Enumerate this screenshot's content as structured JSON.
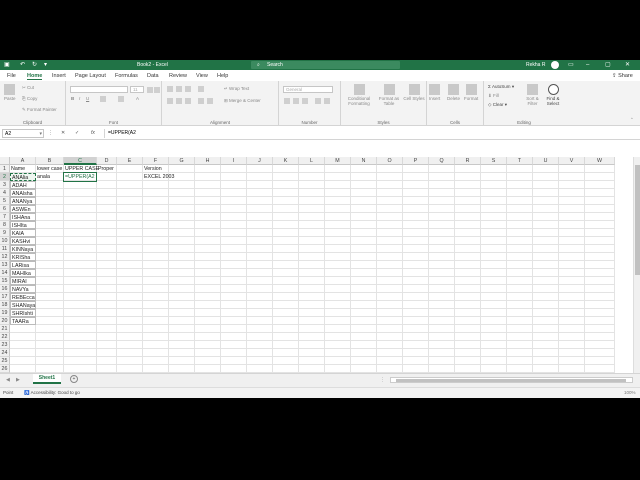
{
  "titlebar": {
    "doc_title": "Book2 - Excel",
    "search_placeholder": "Search",
    "user_name": "Rekha R"
  },
  "tabs": [
    "File",
    "Home",
    "Insert",
    "Page Layout",
    "Formulas",
    "Data",
    "Review",
    "View",
    "Help"
  ],
  "share_label": "Share",
  "ribbon": {
    "clipboard": {
      "paste": "Paste",
      "cut": "Cut",
      "copy": "Copy",
      "format_painter": "Format Painter",
      "group": "Clipboard"
    },
    "font": {
      "group": "Font",
      "size": "11"
    },
    "alignment": {
      "wrap": "Wrap Text",
      "merge": "Merge & Center",
      "group": "Alignment"
    },
    "number": {
      "format": "General",
      "group": "Number"
    },
    "styles": {
      "cond": "Conditional Formatting",
      "table": "Format as Table",
      "cell": "Cell Styles",
      "group": "Styles"
    },
    "cells": {
      "insert": "Insert",
      "delete": "Delete",
      "format": "Format",
      "group": "Cells"
    },
    "editing": {
      "autosum": "AutoSum",
      "fill": "Fill",
      "clear": "Clear",
      "sort": "Sort & Filter",
      "find": "Find & Select",
      "group": "Editing"
    }
  },
  "formula_bar": {
    "name_box": "A2",
    "formula": "=UPPER(A2"
  },
  "sheet": {
    "columns": [
      "A",
      "B",
      "C",
      "D",
      "E",
      "F",
      "G",
      "H",
      "I",
      "J",
      "K",
      "L",
      "M",
      "N",
      "O",
      "P",
      "Q",
      "R",
      "S",
      "T",
      "U",
      "V",
      "W"
    ],
    "rows": [
      "1",
      "2",
      "3",
      "4",
      "5",
      "6",
      "7",
      "8",
      "9",
      "10",
      "11",
      "12",
      "13",
      "14",
      "15",
      "16",
      "17",
      "18",
      "19",
      "20",
      "21",
      "22",
      "23",
      "24",
      "25",
      "26"
    ],
    "headers": {
      "A1": "Name",
      "B1": "lower case",
      "C1": "UPPER CASE",
      "D1": "Proper",
      "F1": "Version"
    },
    "names": [
      "ANAlia",
      "ADAH",
      "ANAlsha",
      "ANANya",
      "ASWEn",
      "ISHAna",
      "ISHIta",
      "KAIA",
      "KASHvi",
      "KINNaya",
      "KRISha",
      "LARisa",
      "MAHIka",
      "MIRAI",
      "NAVYa",
      "REBEcca",
      "SHANaya",
      "SHRIshti",
      "TAARa"
    ],
    "B2": "anala",
    "C2": "=UPPER(A2",
    "F2": "EXCEL 2003"
  },
  "sheet_tab": "Sheet1",
  "status": {
    "mode": "Point",
    "accessibility": "Accessibility: Good to go",
    "zoom": "100%"
  }
}
